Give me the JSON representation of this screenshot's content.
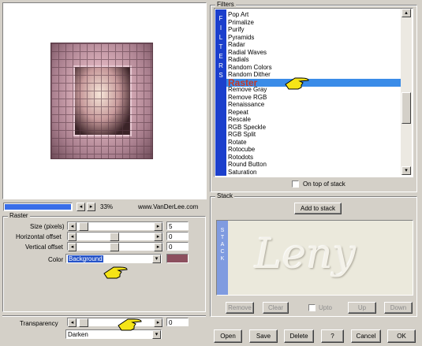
{
  "preview": {
    "zoom_label": "33%",
    "website": "www.VanDerLee.com"
  },
  "raster": {
    "title": "Raster",
    "size_label": "Size (pixels)",
    "size_value": "5",
    "hoffset_label": "Horizontal offset",
    "hoffset_value": "0",
    "voffset_label": "Vertical offset",
    "voffset_value": "0",
    "color_label": "Color",
    "color_value": "Background",
    "color_swatch": "#8c4f5e"
  },
  "transparency": {
    "label": "Transparency",
    "value": "0",
    "mode": "Darken"
  },
  "filters": {
    "title": "Filters",
    "side_label": [
      "F",
      "I",
      "L",
      "T",
      "E",
      "R",
      "S"
    ],
    "items": [
      "Pop Art",
      "Primalize",
      "Purify",
      "Pyramids",
      "Radar",
      "Radial Waves",
      "Radials",
      "Random Colors",
      "Random Dither",
      "Raster",
      "Remove Gray",
      "Remove RGB",
      "Renaissance",
      "Repeat",
      "Rescale",
      "RGB Speckle",
      "RGB Split",
      "Rotate",
      "Rotocube",
      "Rotodots",
      "Round Button",
      "Saturation"
    ],
    "selected": "Raster",
    "selected_color": "#3a8ce8",
    "on_top_label": "On top of stack"
  },
  "stack": {
    "title": "Stack",
    "add_label": "Add to stack",
    "side_label": [
      "S",
      "T",
      "A",
      "C",
      "K"
    ],
    "watermark": "Leny",
    "remove_label": "Remove",
    "clear_label": "Clear",
    "upto_label": "Upto",
    "up_label": "Up",
    "down_label": "Down"
  },
  "buttons": {
    "open": "Open",
    "save": "Save",
    "delete": "Delete",
    "help": "?",
    "cancel": "Cancel",
    "ok": "OK"
  }
}
